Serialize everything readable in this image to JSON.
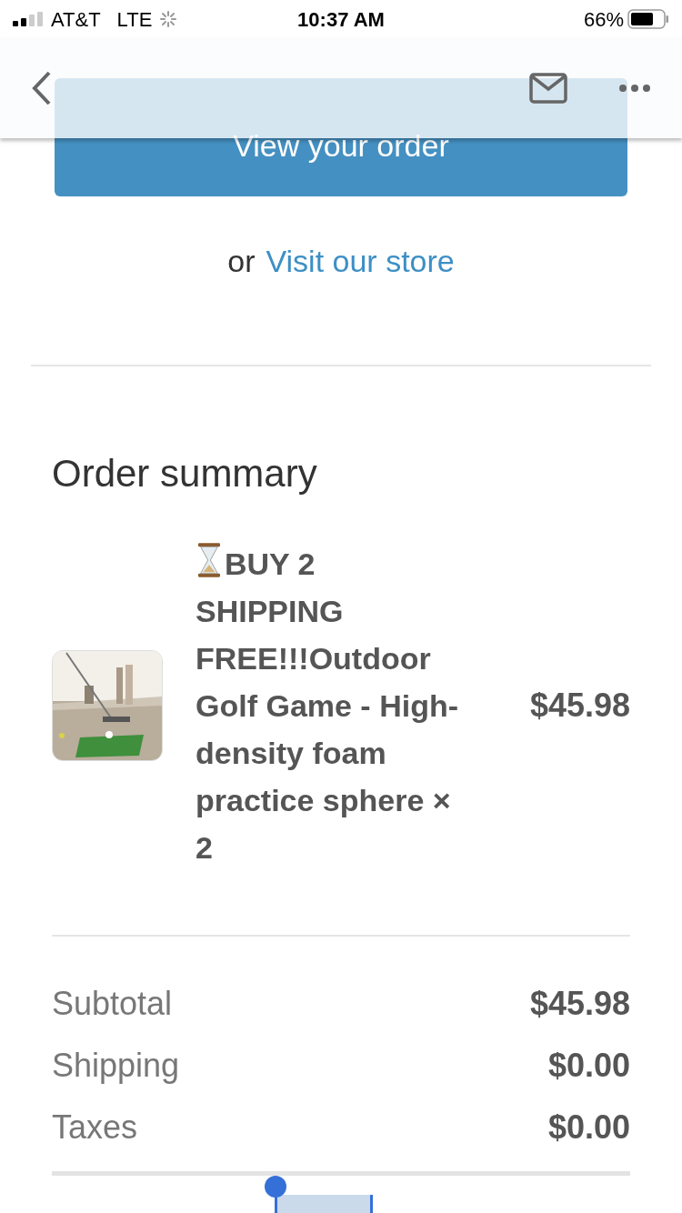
{
  "status_bar": {
    "carrier": "AT&T",
    "network": "LTE",
    "time": "10:37 AM",
    "battery": "66%"
  },
  "top_button": {
    "label": "View your order"
  },
  "store_link": {
    "prefix": "or",
    "link": "Visit our store"
  },
  "order_summary": {
    "title": "Order summary",
    "items": [
      {
        "kind": "picture",
        "title": "BUY 2 SHIPPING FREE!!!Outdoor Golf Game - High-density foam practice sphere × 2",
        "price": "$45.98"
      }
    ]
  },
  "totals": [
    {
      "label": "Subtotal",
      "value": "$45.98"
    },
    {
      "label": "Shipping",
      "value": "$0.00"
    },
    {
      "label": "Taxes",
      "value": "$0.00"
    }
  ]
}
